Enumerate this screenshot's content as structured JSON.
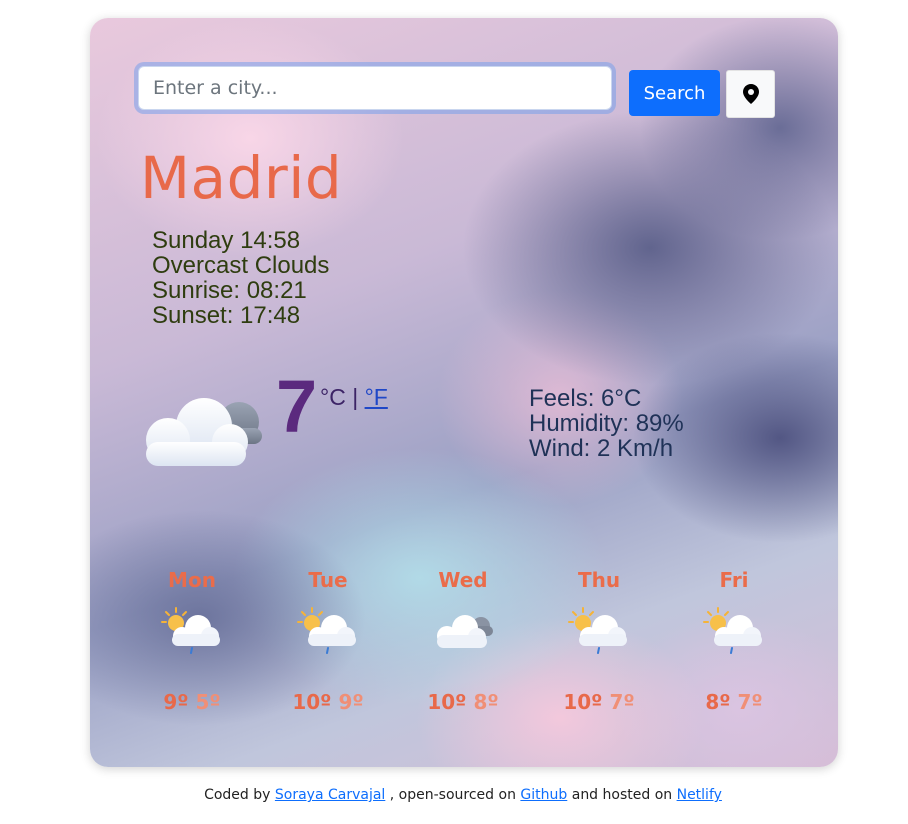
{
  "search": {
    "placeholder": "Enter a city...",
    "value": "",
    "button_label": "Search",
    "location_icon": "map-pin-icon"
  },
  "current": {
    "city": "Madrid",
    "datetime": "Sunday 14:58",
    "description": "Overcast Clouds",
    "sunrise": "Sunrise: 08:21",
    "sunset": "Sunset: 17:48",
    "icon": "overcast-clouds-icon",
    "temperature": "7",
    "unit_celsius": "°C",
    "unit_separator": "|",
    "unit_fahrenheit": "°F",
    "feels": "Feels: 6°C",
    "humidity": "Humidity: 89%",
    "wind": "Wind: 2 Km/h"
  },
  "forecast": [
    {
      "day": "Mon",
      "icon": "sun-cloud-rain-icon",
      "max": "9º",
      "min": "5º"
    },
    {
      "day": "Tue",
      "icon": "sun-cloud-rain-icon",
      "max": "10º",
      "min": "9º"
    },
    {
      "day": "Wed",
      "icon": "overcast-clouds-icon",
      "max": "10º",
      "min": "8º"
    },
    {
      "day": "Thu",
      "icon": "sun-cloud-rain-icon",
      "max": "10º",
      "min": "7º"
    },
    {
      "day": "Fri",
      "icon": "sun-cloud-rain-icon",
      "max": "8º",
      "min": "7º"
    }
  ],
  "footer": {
    "prefix": "Coded by",
    "author": "Soraya Carvajal",
    "middle": ", open-sourced on",
    "repo": "Github",
    "middle2": "and hosted on",
    "host": "Netlify"
  },
  "colors": {
    "accent": "#e8694a",
    "search_button": "#0d6efd",
    "temperature": "#5b2a7e",
    "details_text": "#2f3d10",
    "stats_text": "#1f3257"
  }
}
